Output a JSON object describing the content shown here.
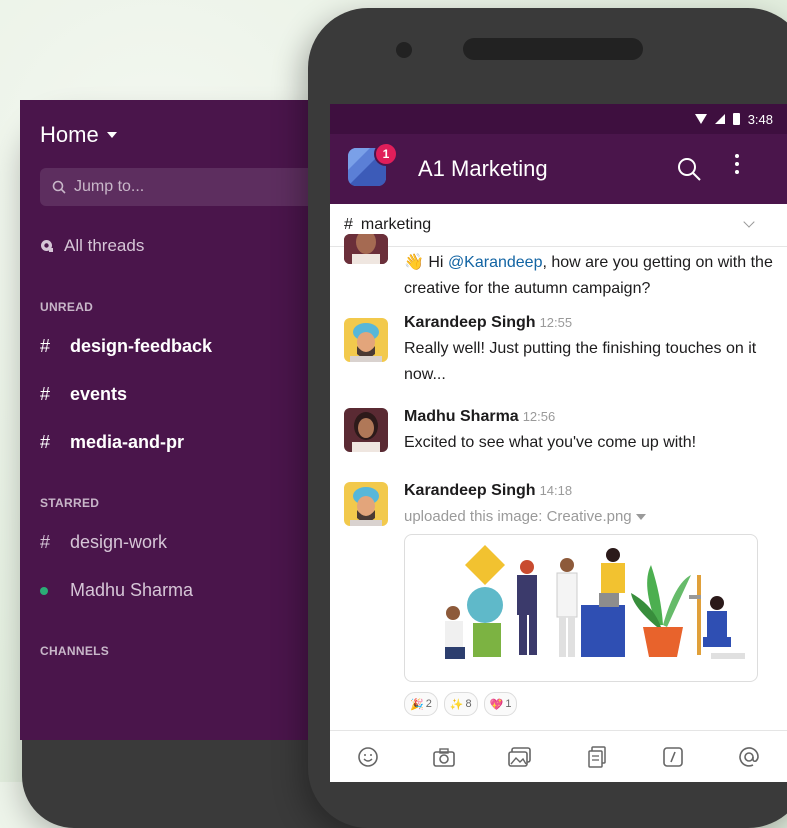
{
  "sidebar": {
    "home_label": "Home",
    "jump_placeholder": "Jump to...",
    "all_threads": "All threads",
    "unread_heading": "UNREAD",
    "unread_channels": [
      "design-feedback",
      "events",
      "media-and-pr"
    ],
    "starred_heading": "STARRED",
    "starred_channel": "design-work",
    "starred_dm": "Madhu Sharma",
    "channels_heading": "CHANNELS"
  },
  "statusbar": {
    "time": "3:48"
  },
  "appbar": {
    "workspace_name": "A1 Marketing",
    "badge_count": "1"
  },
  "channel": {
    "hash": "#",
    "name": "marketing"
  },
  "messages": [
    {
      "text_pre": "Hi ",
      "mention": "@Karandeep",
      "text_post": ", how are you getting on with the creative for the autumn campaign?",
      "emoji": "👋"
    },
    {
      "author": "Karandeep Singh",
      "time": "12:55",
      "text": "Really well! Just putting the finishing touches on it now..."
    },
    {
      "author": "Madhu Sharma",
      "time": "12:56",
      "text": "Excited to see what you've come up with!"
    },
    {
      "author": "Karandeep Singh",
      "time": "14:18",
      "text": "uploaded this image: Creative.png"
    }
  ],
  "reactions": [
    {
      "emoji": "🎉",
      "count": "2"
    },
    {
      "emoji": "✨",
      "count": "8"
    },
    {
      "emoji": "💖",
      "count": "1"
    }
  ],
  "hash": "#"
}
